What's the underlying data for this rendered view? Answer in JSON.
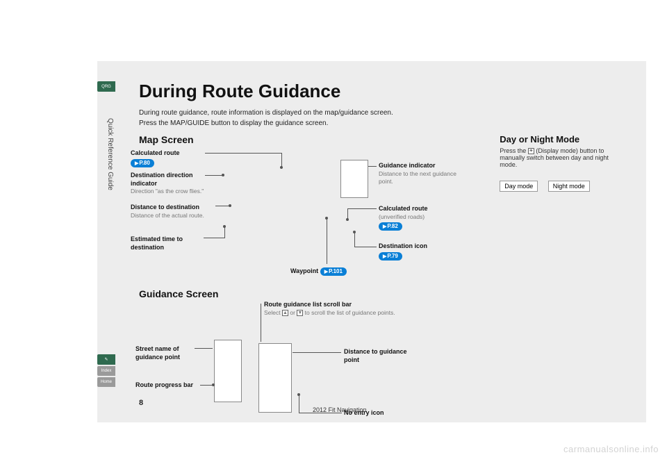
{
  "sidebar_label": "Quick Reference Guide",
  "tabs": {
    "qrg": "QRG",
    "index": "Index",
    "home": "Home"
  },
  "title": "During Route Guidance",
  "intro_line1": "During route guidance, route information is displayed on the map/guidance screen.",
  "intro_line2": "Press the MAP/GUIDE button to display the guidance screen.",
  "map_section": {
    "heading": "Map Screen",
    "calculated_route": {
      "label": "Calculated route",
      "pill": "P.80"
    },
    "dest_direction": {
      "label": "Destination direction indicator",
      "sub": "Direction \"as the crow flies.\""
    },
    "dist_dest": {
      "label": "Distance to destination",
      "sub": "Distance of the actual route."
    },
    "eta": {
      "label": "Estimated time to destination"
    },
    "waypoint": {
      "label": "Waypoint",
      "pill": "P.101"
    },
    "guidance_ind": {
      "label": "Guidance indicator",
      "sub": "Distance to the next guidance point."
    },
    "calc_unverified": {
      "label": "Calculated route",
      "sub": "(unverified roads)",
      "pill": "P.82"
    },
    "dest_icon": {
      "label": "Destination icon",
      "pill": "P.79"
    }
  },
  "guidance_section": {
    "heading": "Guidance Screen",
    "scrollbar": {
      "label": "Route guidance list scroll bar",
      "sub_pre": "Select ",
      "sub_mid": " or ",
      "sub_post": " to scroll the list of guidance points."
    },
    "street_name": {
      "label": "Street name of guidance point"
    },
    "progress": {
      "label": "Route progress bar"
    },
    "distance": {
      "label": "Distance to guidance point"
    },
    "noentry": {
      "label": "No entry icon"
    }
  },
  "right_section": {
    "heading": "Day or Night Mode",
    "text_pre": "Press the ",
    "text_post": " (Display mode) button to manually switch between day and night mode.",
    "day_btn": "Day mode",
    "night_btn": "Night mode"
  },
  "page_num": "8",
  "footer": "2012 Fit Navigation",
  "watermark": "carmanualsonline.info"
}
